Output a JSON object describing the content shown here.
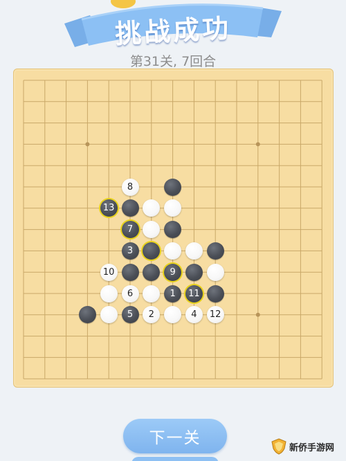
{
  "header": {
    "title": "挑战成功",
    "subtitle": "第31关, 7回合"
  },
  "board": {
    "size": 15,
    "star_points": [
      [
        3,
        3
      ],
      [
        11,
        3
      ],
      [
        3,
        11
      ],
      [
        11,
        11
      ]
    ],
    "stones": [
      {
        "col": 5,
        "row": 5,
        "color": "white",
        "label": "8"
      },
      {
        "col": 7,
        "row": 5,
        "color": "black",
        "label": ""
      },
      {
        "col": 4,
        "row": 6,
        "color": "black",
        "label": "13",
        "marked": true
      },
      {
        "col": 5,
        "row": 6,
        "color": "black",
        "label": ""
      },
      {
        "col": 6,
        "row": 6,
        "color": "white",
        "label": ""
      },
      {
        "col": 7,
        "row": 6,
        "color": "white",
        "label": ""
      },
      {
        "col": 5,
        "row": 7,
        "color": "black",
        "label": "7",
        "marked": true
      },
      {
        "col": 6,
        "row": 7,
        "color": "white",
        "label": ""
      },
      {
        "col": 7,
        "row": 7,
        "color": "black",
        "label": ""
      },
      {
        "col": 5,
        "row": 8,
        "color": "black",
        "label": "3"
      },
      {
        "col": 6,
        "row": 8,
        "color": "black",
        "label": "",
        "marked": true
      },
      {
        "col": 7,
        "row": 8,
        "color": "white",
        "label": ""
      },
      {
        "col": 8,
        "row": 8,
        "color": "white",
        "label": ""
      },
      {
        "col": 9,
        "row": 8,
        "color": "black",
        "label": ""
      },
      {
        "col": 4,
        "row": 9,
        "color": "white",
        "label": "10"
      },
      {
        "col": 5,
        "row": 9,
        "color": "black",
        "label": ""
      },
      {
        "col": 6,
        "row": 9,
        "color": "black",
        "label": ""
      },
      {
        "col": 7,
        "row": 9,
        "color": "black",
        "label": "9",
        "marked": true
      },
      {
        "col": 8,
        "row": 9,
        "color": "black",
        "label": ""
      },
      {
        "col": 9,
        "row": 9,
        "color": "white",
        "label": ""
      },
      {
        "col": 4,
        "row": 10,
        "color": "white",
        "label": ""
      },
      {
        "col": 5,
        "row": 10,
        "color": "white",
        "label": "6"
      },
      {
        "col": 6,
        "row": 10,
        "color": "white",
        "label": ""
      },
      {
        "col": 7,
        "row": 10,
        "color": "black",
        "label": "1"
      },
      {
        "col": 8,
        "row": 10,
        "color": "black",
        "label": "11",
        "marked": true
      },
      {
        "col": 9,
        "row": 10,
        "color": "black",
        "label": ""
      },
      {
        "col": 3,
        "row": 11,
        "color": "black",
        "label": ""
      },
      {
        "col": 4,
        "row": 11,
        "color": "white",
        "label": ""
      },
      {
        "col": 5,
        "row": 11,
        "color": "black",
        "label": "5"
      },
      {
        "col": 6,
        "row": 11,
        "color": "white",
        "label": "2"
      },
      {
        "col": 7,
        "row": 11,
        "color": "white",
        "label": ""
      },
      {
        "col": 8,
        "row": 11,
        "color": "white",
        "label": "4"
      },
      {
        "col": 9,
        "row": 11,
        "color": "white",
        "label": "12"
      }
    ]
  },
  "buttons": {
    "next_level": "下一关"
  },
  "watermark": {
    "text": "新侨手游网",
    "icon": "shield-logo-icon"
  },
  "colors": {
    "board": "#f7dda2",
    "grid_line": "#c9a868",
    "banner": "#8cc0f4",
    "button": "#8ec0f3",
    "mark": "#e8d21a"
  }
}
